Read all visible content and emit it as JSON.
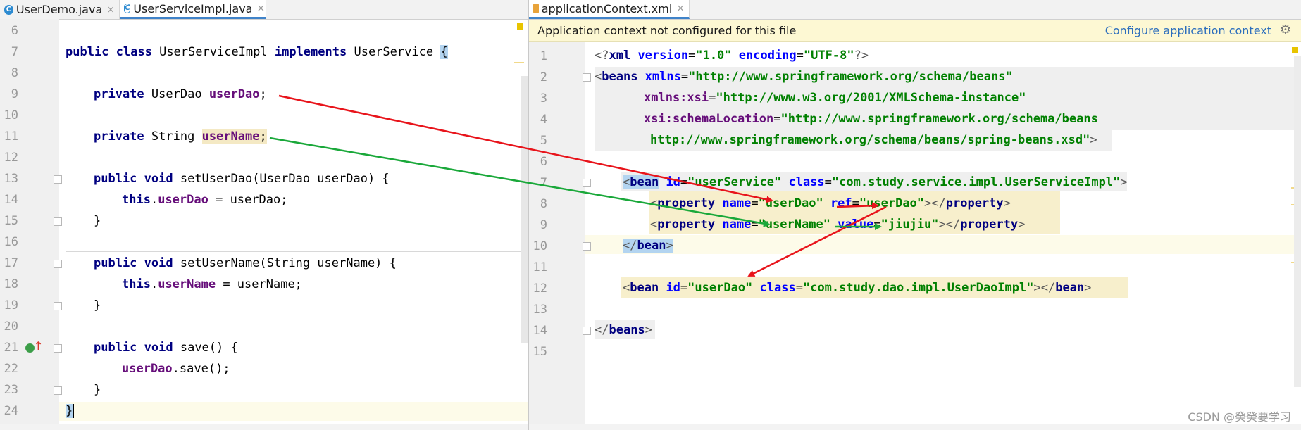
{
  "left_tabs": [
    {
      "label": "UserDemo.java",
      "close": "×"
    },
    {
      "label": "UserServiceImpl.java",
      "close": "×"
    }
  ],
  "right_tabs": [
    {
      "label": "applicationContext.xml",
      "close": "×"
    }
  ],
  "banner": {
    "message": "Application context not configured for this file",
    "action": "Configure application context",
    "gear": "⚙"
  },
  "java_line_numbers": [
    "6",
    "7",
    "8",
    "9",
    "10",
    "11",
    "12",
    "13",
    "14",
    "15",
    "16",
    "17",
    "18",
    "19",
    "20",
    "21",
    "22",
    "23",
    "24"
  ],
  "java_code": {
    "l7": {
      "kw1": "public class",
      "name": "UserServiceImpl",
      "kw2": "implements",
      "iface": "UserService",
      "brace": "{"
    },
    "l9": {
      "kw": "private",
      "type": "UserDao",
      "field": "userDao",
      "semi": ";"
    },
    "l11": {
      "kw": "private",
      "type": "String",
      "field": "userName",
      "semi": ";"
    },
    "l13": {
      "kw": "public void",
      "sig": "setUserDao(UserDao userDao) {"
    },
    "l14": {
      "this": "this",
      "dot": ".",
      "field": "userDao",
      "rest": " = userDao;"
    },
    "l15": {
      "text": "}"
    },
    "l17": {
      "kw": "public void",
      "sig": "setUserName(String userName) {"
    },
    "l18": {
      "this": "this",
      "dot": ".",
      "field": "userName",
      "rest": " = userName;"
    },
    "l19": {
      "text": "}"
    },
    "l21": {
      "kw": "public void",
      "sig": "save() {"
    },
    "l22": {
      "field": "userDao",
      "rest": ".save();"
    },
    "l23": {
      "text": "}"
    },
    "l24": {
      "text": "}"
    }
  },
  "xml_line_numbers": [
    "1",
    "2",
    "3",
    "4",
    "5",
    "6",
    "7",
    "8",
    "9",
    "10",
    "11",
    "12",
    "13",
    "14",
    "15"
  ],
  "xml_code": {
    "l1": {
      "open": "<?",
      "tag": "xml",
      "a1": " version",
      "eq1": "=",
      "v1": "\"1.0\"",
      "a2": " encoding",
      "eq2": "=",
      "v2": "\"UTF-8\"",
      "close": "?>"
    },
    "l2": {
      "lt": "<",
      "tag": "beans",
      "attr": " xmlns",
      "eq": "=",
      "val": "\"http://www.springframework.org/schema/beans\""
    },
    "l3": {
      "attr": "xmlns:xsi",
      "eq": "=",
      "val": "\"http://www.w3.org/2001/XMLSchema-instance\""
    },
    "l4": {
      "attr": "xsi:schemaLocation",
      "eq": "=",
      "val": "\"http://www.springframework.org/schema/beans"
    },
    "l5": {
      "val": "http://www.springframework.org/schema/beans/spring-beans.xsd\"",
      "gt": ">"
    },
    "l7": {
      "lt": "<",
      "tag": "bean",
      "a1": " id",
      "eq1": "=",
      "v1": "\"userService\"",
      "a2": " class",
      "eq2": "=",
      "v2": "\"com.study.service.impl.UserServiceImpl\"",
      "gt": ">"
    },
    "l8": {
      "lt": "<",
      "tag": "property",
      "a1": " name",
      "eq1": "=",
      "v1": "\"userDao\"",
      "a2": " ref",
      "eq2": "=",
      "v2": "\"userDao\"",
      "mid": "></",
      "tag2": "property",
      "gt": ">"
    },
    "l9": {
      "lt": "<",
      "tag": "property",
      "a1": " name",
      "eq1": "=",
      "v1": "\"userName\"",
      "a2": " value",
      "eq2": "=",
      "v2": "\"jiujiu\"",
      "mid": "></",
      "tag2": "property",
      "gt": ">"
    },
    "l10": {
      "lt": "</",
      "tag": "bean",
      "gt": ">"
    },
    "l12": {
      "lt": "<",
      "tag": "bean",
      "a1": " id",
      "eq1": "=",
      "v1": "\"userDao\"",
      "a2": " class",
      "eq2": "=",
      "v2": "\"com.study.dao.impl.UserDaoImpl\"",
      "mid": "></",
      "tag2": "bean",
      "gt": ">"
    },
    "l14": {
      "lt": "</",
      "tag": "beans",
      "gt": ">"
    }
  },
  "gutter_icons": {
    "implements_marker": "I",
    "override_arrow": "↑"
  },
  "watermark": "CSDN @癸癸要学习",
  "colors": {
    "arrow_red": "#e8141b",
    "arrow_green": "#1aa83a",
    "keyword": "#000080",
    "field": "#660e7a",
    "xml_value": "#008000",
    "xml_attr": "#0000ff",
    "tab_accent": "#4083c9"
  }
}
